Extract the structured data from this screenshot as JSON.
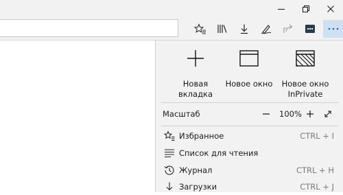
{
  "window_controls": {
    "minimize_icon": "minimize-icon",
    "restore_icon": "restore-icon",
    "close_icon": "close-icon"
  },
  "toolbar": {
    "address_value": "",
    "buttons": [
      {
        "name": "favorites-add-icon"
      },
      {
        "name": "hub-icon"
      },
      {
        "name": "downloads-icon"
      },
      {
        "name": "web-note-icon"
      },
      {
        "name": "share-icon"
      },
      {
        "name": "extension-icon"
      },
      {
        "name": "more-icon",
        "label": "···"
      }
    ]
  },
  "menu": {
    "new_tab": {
      "label": "Новая вкладка"
    },
    "new_window": {
      "label": "Новое окно"
    },
    "new_inprivate": {
      "label": "Новое окно InPrivate"
    },
    "zoom": {
      "label": "Масштаб",
      "value": "100%",
      "minus": "−",
      "plus": "+"
    },
    "items": [
      {
        "label": "Избранное",
        "shortcut": "CTRL + I",
        "icon": "favorites-icon"
      },
      {
        "label": "Список для чтения",
        "shortcut": "",
        "icon": "reading-list-icon"
      },
      {
        "label": "Журнал",
        "shortcut": "CTRL + H",
        "icon": "history-icon"
      },
      {
        "label": "Загрузки",
        "shortcut": "CTRL + J",
        "icon": "download-icon"
      }
    ]
  },
  "colors": {
    "chrome_bg": "#f2f2f2",
    "active_button": "#cfe0f3",
    "text": "#1a1a1a",
    "shortcut_text": "#7a7a7a"
  }
}
